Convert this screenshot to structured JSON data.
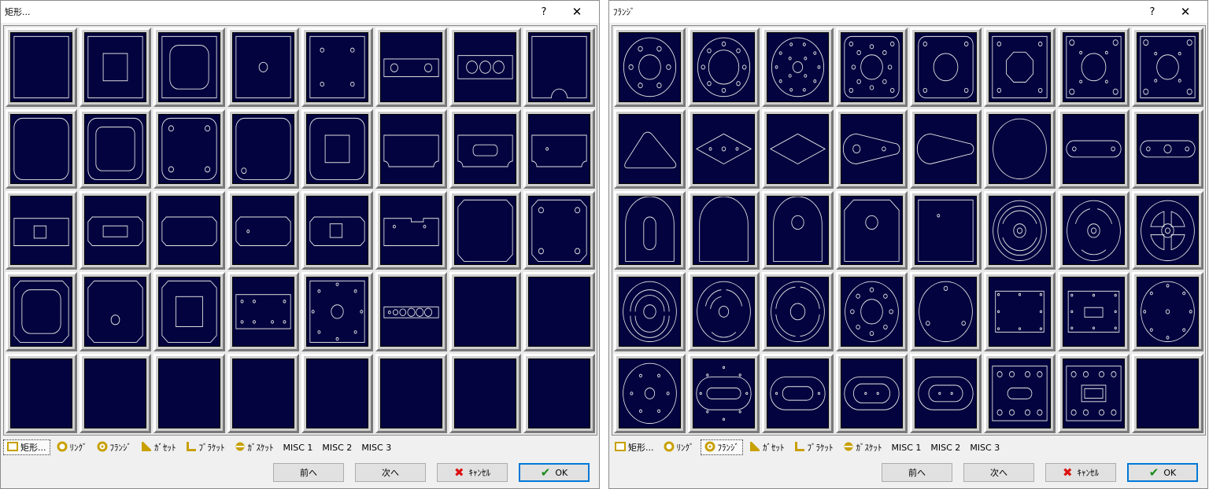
{
  "left": {
    "title": "矩形...",
    "help": "?",
    "close": "✕",
    "tabs": [
      {
        "label": "矩形...",
        "icon": "rect-icon",
        "active": true
      },
      {
        "label": "ﾘﾝｸﾞ",
        "icon": "ring-icon"
      },
      {
        "label": "ﾌﾗﾝｼﾞ",
        "icon": "flange-icon"
      },
      {
        "label": "ｶﾞｾｯﾄ",
        "icon": "gusset-icon"
      },
      {
        "label": "ﾌﾞﾗｹｯﾄ",
        "icon": "bracket-icon"
      },
      {
        "label": "ｶﾞｽｹｯﾄ",
        "icon": "gasket-icon"
      },
      {
        "label": "MISC 1"
      },
      {
        "label": "MISC 2"
      },
      {
        "label": "MISC 3"
      }
    ],
    "buttons": {
      "prev": "前へ",
      "next": "次へ",
      "cancel": "ｷｬﾝｾﾙ",
      "ok": "OK"
    },
    "shapes": [
      "rect-plain",
      "rect-inner-square",
      "rect-rounded-inner",
      "rect-center-hole",
      "rect-four-holes",
      "rect-slot-two-holes",
      "rect-slot-three-holes",
      "rect-bottom-notch",
      "rounded-plain",
      "rounded-inner-rounded",
      "rounded-four-holes",
      "rounded-one-hole",
      "rounded-inner-square",
      "rect-corner-cut",
      "rect-cut-slot",
      "rect-cut-hole",
      "chamfer-small-square",
      "chamfer-rect",
      "chamfer-plain",
      "chamfer-hole",
      "chamfer-square",
      "notch-rect",
      "octagon-plain",
      "octagon-four-holes",
      "octagon-rounded-inner",
      "octagon-hole",
      "octagon-square",
      "rect-six-holes",
      "rect-bolt-circle",
      "rect-hole-row",
      "empty",
      "empty",
      "empty",
      "empty",
      "empty",
      "empty",
      "empty",
      "empty",
      "empty",
      "empty"
    ]
  },
  "right": {
    "title": "ﾌﾗﾝｼﾞ",
    "help": "?",
    "close": "✕",
    "tabs": [
      {
        "label": "矩形...",
        "icon": "rect-icon"
      },
      {
        "label": "ﾘﾝｸﾞ",
        "icon": "ring-icon"
      },
      {
        "label": "ﾌﾗﾝｼﾞ",
        "icon": "flange-icon",
        "active": true
      },
      {
        "label": "ｶﾞｾｯﾄ",
        "icon": "gusset-icon"
      },
      {
        "label": "ﾌﾞﾗｹｯﾄ",
        "icon": "bracket-icon"
      },
      {
        "label": "ｶﾞｽｹｯﾄ",
        "icon": "gasket-icon"
      },
      {
        "label": "MISC 1"
      },
      {
        "label": "MISC 2"
      },
      {
        "label": "MISC 3"
      }
    ],
    "buttons": {
      "prev": "前へ",
      "next": "次へ",
      "cancel": "ｷｬﾝｾﾙ",
      "ok": "OK"
    },
    "shapes": [
      "flange-circle-six",
      "flange-circle-eight",
      "flange-circle-bolt",
      "flange-square-rounded",
      "flange-square-hole",
      "flange-square-octagon",
      "flange-square-four",
      "flange-square-diamond",
      "tri-rounded",
      "diamond-two-holes",
      "diamond-plain",
      "teardrop-holes",
      "teardrop-plain",
      "circle-plain",
      "slot-two-holes",
      "slot-three-holes",
      "arch-slot",
      "arch-plain",
      "arch-hole",
      "cut-square-hole",
      "rect-small-hole",
      "ring-spokes-a",
      "ring-spokes-b",
      "ring-spokes-c",
      "ring-arc-a",
      "ring-arc-b",
      "ring-arc-c",
      "circle-bolt-pattern",
      "circle-three-holes",
      "rect-hole-border",
      "rect-slot-border",
      "circle-eight-holes",
      "circle-six-holes",
      "oval-slot",
      "oval-slot-holes",
      "oval-ring-holes",
      "oval-small-slot",
      "rect-hole-grid",
      "rect-grid-slot",
      "empty"
    ]
  }
}
